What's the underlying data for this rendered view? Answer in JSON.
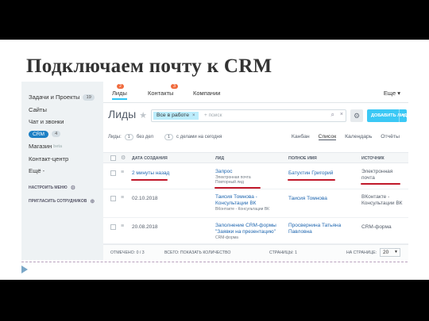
{
  "slide": {
    "title": "Подключаем почту к CRM"
  },
  "sidebar": {
    "items": [
      {
        "label": "Задачи и Проекты",
        "badge": "19"
      },
      {
        "label": "Сайты"
      },
      {
        "label": "Чат и звонки"
      },
      {
        "label": "CRM",
        "badge": "4"
      },
      {
        "label": "Магазин",
        "beta": "beta"
      },
      {
        "label": "Контакт-центр"
      },
      {
        "label": "Ещё -"
      }
    ],
    "settings_menu": "НАСТРОИТЬ МЕНЮ",
    "invite": "ПРИГЛАСИТЬ СОТРУДНИКОВ"
  },
  "topnav": {
    "tabs": [
      {
        "label": "Лиды",
        "badge": "2"
      },
      {
        "label": "Контакты",
        "badge": "3"
      },
      {
        "label": "Компании"
      }
    ],
    "more": "Еще ▾"
  },
  "header": {
    "title": "Лиды",
    "filter_tag": "Все в работе",
    "search_placeholder": "+ поиск",
    "add_button": "ДОБАВИТЬ ЛИД"
  },
  "counters": {
    "prefix": "Лиды:",
    "no_deal_count": "1",
    "no_deal_label": "без дел",
    "today_count": "1",
    "today_label": "с делами на сегодня"
  },
  "views": [
    "Канбан",
    "Список",
    "Календарь",
    "Отчёты"
  ],
  "table": {
    "columns": [
      "ДАТА СОЗДАНИЯ",
      "ЛИД",
      "ПОЛНОЕ ИМЯ",
      "ИСТОЧНИК"
    ],
    "rows": [
      {
        "date": "2 минуты назад",
        "lead": "Запрос",
        "lead_sub1": "Электронная почта",
        "lead_sub2": "Повторный лид",
        "name": "Батухтин Григорий",
        "source": "Электронная почта"
      },
      {
        "date": "02.10.2018",
        "lead": "Таисия Томнова - Консультации ВК",
        "lead_sub1": "ВКонтакте - Консультации ВК",
        "name": "Таисия Томнова",
        "source": "ВКонтакте - Консультации ВК"
      },
      {
        "date": "20.08.2018",
        "lead": "Заполнение CRM-формы \"Заявки на презентацию\"",
        "lead_sub1": "CRM-форма",
        "name": "Просвернина Татьяна Павловна",
        "source": "CRM-форма"
      }
    ]
  },
  "footer": {
    "selected": "ОТМЕЧЕНО: 0 / 3",
    "total": "ВСЕГО: ПОКАЗАТЬ КОЛИЧЕСТВО",
    "pages": "СТРАНИЦЫ: 1",
    "per_page_label": "НА СТРАНИЦЕ:",
    "per_page_value": "20"
  },
  "colors": {
    "accent": "#3bc8f5",
    "crm_badge": "#1c7fc4",
    "nav_badge": "#f06a3c",
    "underline": "#c0182a"
  }
}
